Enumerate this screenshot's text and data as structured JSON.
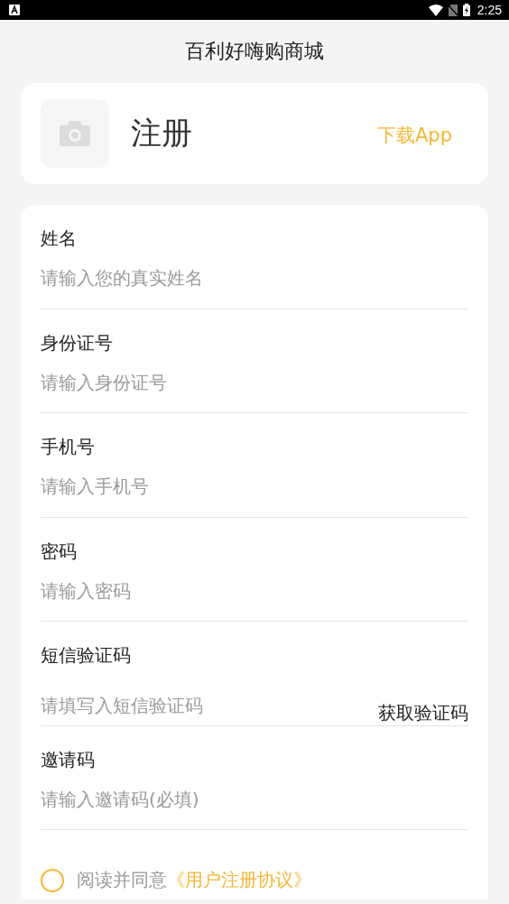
{
  "status_bar": {
    "time": "2:25"
  },
  "header": {
    "title": "百利好嗨购商城"
  },
  "profile_card": {
    "title": "注册",
    "download_link": "下载App"
  },
  "form": {
    "fields": [
      {
        "kind": "text",
        "label": "姓名",
        "placeholder": "请输入您的真实姓名"
      },
      {
        "kind": "text",
        "label": "身份证号",
        "placeholder": "请输入身份证号"
      },
      {
        "kind": "text",
        "label": "手机号",
        "placeholder": "请输入手机号"
      },
      {
        "kind": "text",
        "label": "密码",
        "placeholder": "请输入密码"
      },
      {
        "kind": "code",
        "label": "短信验证码",
        "placeholder": "请填写入短信验证码",
        "button": "获取验证码"
      },
      {
        "kind": "text",
        "label": "邀请码",
        "placeholder": "请输入邀请码(必填)"
      }
    ],
    "agreement": {
      "checked": false,
      "text": "阅读并同意",
      "link": "《用户注册协议》"
    }
  }
}
